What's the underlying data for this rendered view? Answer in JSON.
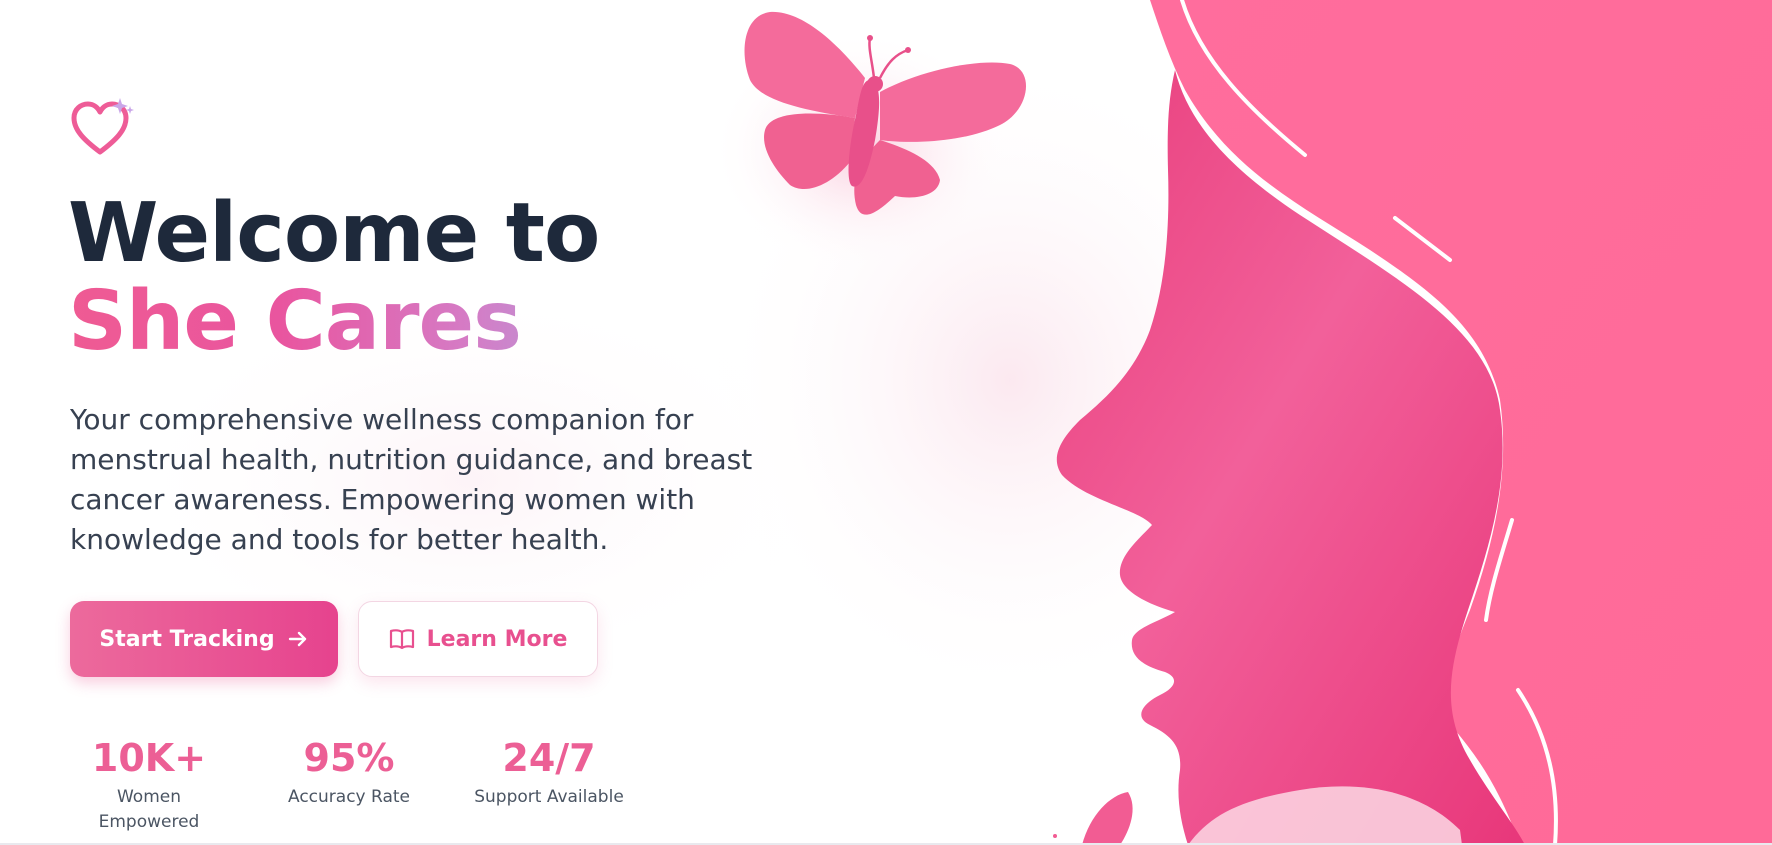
{
  "hero": {
    "headline_line1": "Welcome to",
    "headline_line2": "She Cares",
    "subtitle": "Your comprehensive wellness companion for menstrual health, nutrition guidance, and breast cancer awareness. Empowering women with knowledge and tools for better health."
  },
  "buttons": {
    "primary_label": "Start Tracking",
    "secondary_label": "Learn More"
  },
  "stats": [
    {
      "value": "10K+",
      "label": "Women Empowered"
    },
    {
      "value": "95%",
      "label": "Accuracy Rate"
    },
    {
      "value": "24/7",
      "label": "Support Available"
    }
  ],
  "icons": {
    "logo": "heart-sparkle-icon",
    "primary_button": "arrow-right-icon",
    "secondary_button": "book-open-icon"
  },
  "colors": {
    "brand_pink": "#ec5f95",
    "headline_dark": "#1e293b",
    "text_body": "#374151",
    "art_pink": "#ff6b9a",
    "accent_lavender": "#b89ad9"
  }
}
